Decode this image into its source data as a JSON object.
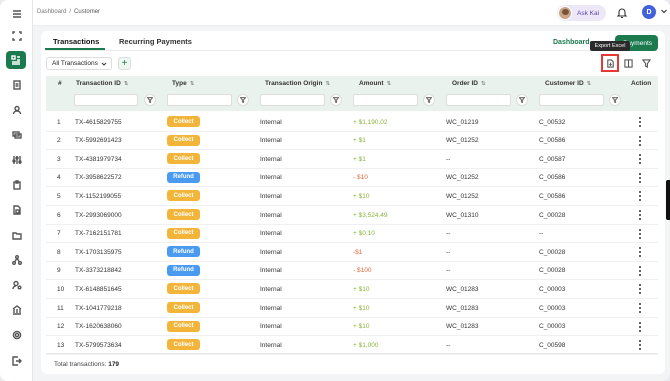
{
  "breadcrumb": {
    "parent": "Dashboard",
    "separator": "/",
    "current": "Customer"
  },
  "header": {
    "ask_label": "Ask Kai",
    "user_initial": "D"
  },
  "tabs": [
    {
      "label": "Transactions",
      "active": true
    },
    {
      "label": "Recurring Payments",
      "active": false
    }
  ],
  "actions": {
    "dashboard_label": "Dashboard",
    "payments_label": "Payments",
    "export_tooltip": "Export Excel"
  },
  "filter": {
    "selected": "All Transactions"
  },
  "columns": [
    "#",
    "Transaction ID",
    "Type",
    "Transaction Origin",
    "Amount",
    "Order ID",
    "Customer ID",
    "Action"
  ],
  "rows": [
    {
      "n": "1",
      "id": "TX-4615829755",
      "type": "Collect",
      "origin": "Internal",
      "amount": "+ $1,190.02",
      "order": "WC_01219",
      "customer": "C_00532"
    },
    {
      "n": "2",
      "id": "TX-5992691423",
      "type": "Collect",
      "origin": "Internal",
      "amount": "+ $1",
      "order": "WC_01252",
      "customer": "C_00586"
    },
    {
      "n": "3",
      "id": "TX-4381979734",
      "type": "Collect",
      "origin": "Internal",
      "amount": "+ $1",
      "order": "--",
      "customer": "C_00587"
    },
    {
      "n": "4",
      "id": "TX-3958622572",
      "type": "Refund",
      "origin": "Internal",
      "amount": "- $10",
      "order": "WC_01252",
      "customer": "C_00586"
    },
    {
      "n": "5",
      "id": "TX-1152199055",
      "type": "Collect",
      "origin": "Internal",
      "amount": "+ $10",
      "order": "WC_01252",
      "customer": "C_00586"
    },
    {
      "n": "6",
      "id": "TX-2993069000",
      "type": "Collect",
      "origin": "Internal",
      "amount": "+ $3,524.49",
      "order": "WC_01310",
      "customer": "C_00028"
    },
    {
      "n": "7",
      "id": "TX-7162151781",
      "type": "Collect",
      "origin": "Internal",
      "amount": "+ $0.10",
      "order": "--",
      "customer": "--"
    },
    {
      "n": "8",
      "id": "TX-1703135975",
      "type": "Refund",
      "origin": "Internal",
      "amount": "-$1",
      "order": "--",
      "customer": "C_00028"
    },
    {
      "n": "9",
      "id": "TX-3373218842",
      "type": "Refund",
      "origin": "Internal",
      "amount": "- $100",
      "order": "--",
      "customer": "C_00028"
    },
    {
      "n": "10",
      "id": "TX-6148851645",
      "type": "Collect",
      "origin": "Internal",
      "amount": "+ $10",
      "order": "WC_01283",
      "customer": "C_00003"
    },
    {
      "n": "11",
      "id": "TX-1041779218",
      "type": "Collect",
      "origin": "Internal",
      "amount": "+ $10",
      "order": "WC_01283",
      "customer": "C_00003"
    },
    {
      "n": "12",
      "id": "TX-1620638060",
      "type": "Collect",
      "origin": "Internal",
      "amount": "+ $10",
      "order": "WC_01283",
      "customer": "C_00003"
    },
    {
      "n": "13",
      "id": "TX-5799573634",
      "type": "Collect",
      "origin": "Internal",
      "amount": "+ $1,000",
      "order": "--",
      "customer": "C_00598"
    }
  ],
  "footer": {
    "label": "Total transactions:",
    "count": "179"
  },
  "colors": {
    "accent": "#1b7a4e",
    "collect": "#f2b53a",
    "refund": "#4a9af0",
    "positive": "#8ab43b",
    "negative": "#e06b3a"
  }
}
